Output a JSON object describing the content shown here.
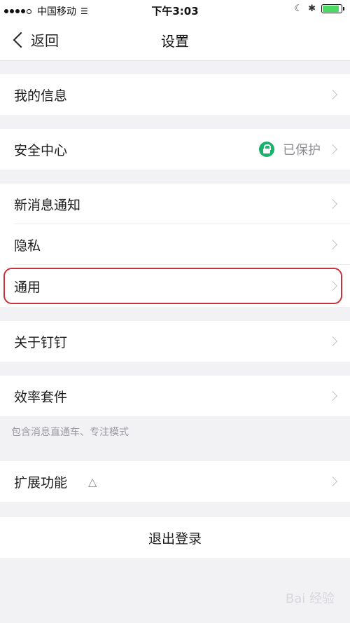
{
  "status_bar": {
    "carrier": "中国移动",
    "time": "下午3:03",
    "battery_level": 0.9,
    "battery_color": "#4cd964"
  },
  "nav": {
    "back_label": "返回",
    "title": "设置"
  },
  "groups": {
    "my_info": {
      "label": "我的信息"
    },
    "security": {
      "label": "安全中心",
      "status": "已保护",
      "status_icon": "lock-icon",
      "status_color": "#19b26b"
    },
    "notifications": {
      "label": "新消息通知"
    },
    "privacy": {
      "label": "隐私"
    },
    "general": {
      "label": "通用",
      "highlighted": true,
      "highlight_color": "#c8323c"
    },
    "about": {
      "label": "关于钉钉"
    },
    "efficiency": {
      "label": "效率套件",
      "footnote": "包含消息直通车、专注模式"
    },
    "extensions": {
      "label": "扩展功能",
      "icon": "flask-icon"
    }
  },
  "logout": {
    "label": "退出登录"
  },
  "watermark": {
    "text": "Bai 经验"
  }
}
